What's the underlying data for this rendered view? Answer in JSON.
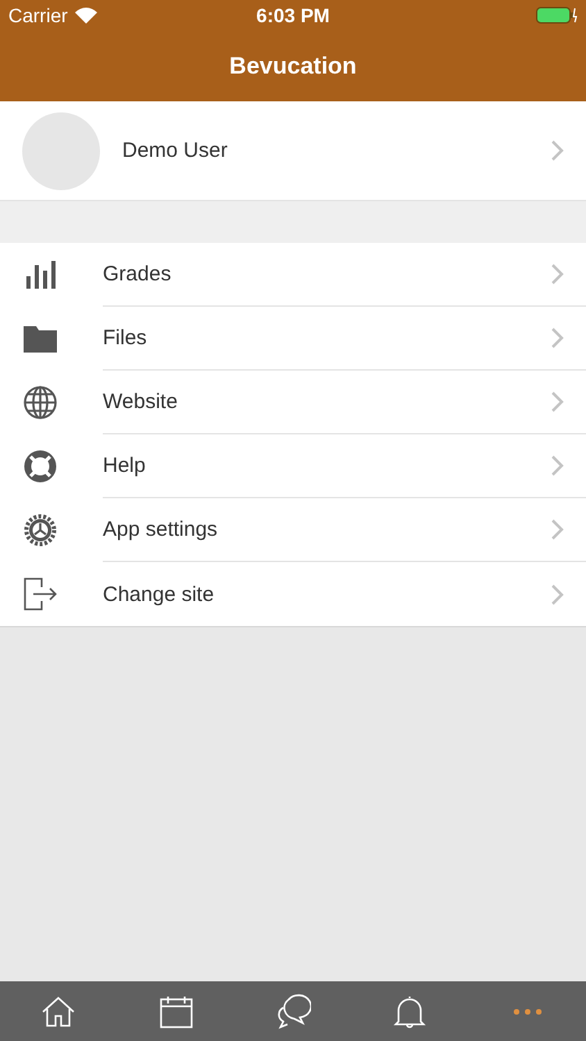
{
  "status_bar": {
    "carrier": "Carrier",
    "time": "6:03 PM"
  },
  "nav_bar": {
    "title": "Bevucation"
  },
  "profile": {
    "name": "Demo User"
  },
  "menu": [
    {
      "kind": "grades",
      "label": "Grades"
    },
    {
      "kind": "files",
      "label": "Files"
    },
    {
      "kind": "website",
      "label": "Website"
    },
    {
      "kind": "help",
      "label": "Help"
    },
    {
      "kind": "settings",
      "label": "App settings"
    },
    {
      "kind": "logout",
      "label": "Change site"
    }
  ],
  "tab_bar": [
    {
      "kind": "home",
      "selected": false
    },
    {
      "kind": "calendar",
      "selected": false
    },
    {
      "kind": "messages",
      "selected": false
    },
    {
      "kind": "notifications",
      "selected": false
    },
    {
      "kind": "more",
      "selected": true
    }
  ]
}
